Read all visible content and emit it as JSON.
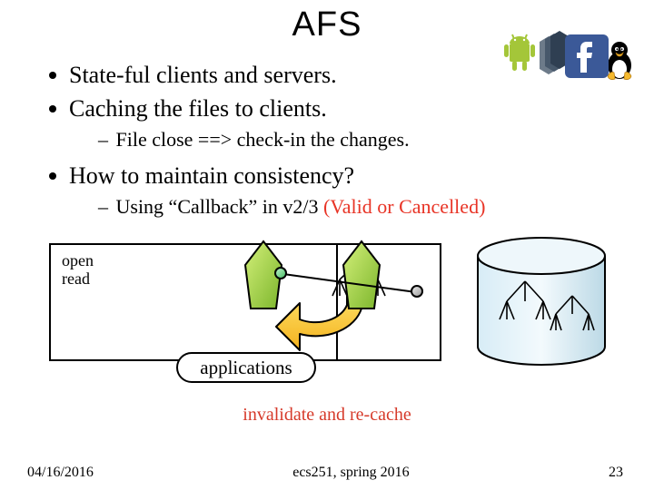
{
  "title": "AFS",
  "bullets": [
    {
      "text": "State-ful clients and servers."
    },
    {
      "text": "Caching the files to clients.",
      "sub": [
        "File close ==> check-in the changes."
      ]
    },
    {
      "text": "How to maintain consistency?",
      "sub": [
        "Using “Callback” in v2/3 "
      ],
      "sub_red": "(Valid or Cancelled)"
    }
  ],
  "diagram": {
    "open": "open",
    "read": "read",
    "applications": "applications",
    "caption": "invalidate and re-cache"
  },
  "footer": {
    "date": "04/16/2016",
    "course": "ecs251, spring 2016",
    "page": "23"
  }
}
